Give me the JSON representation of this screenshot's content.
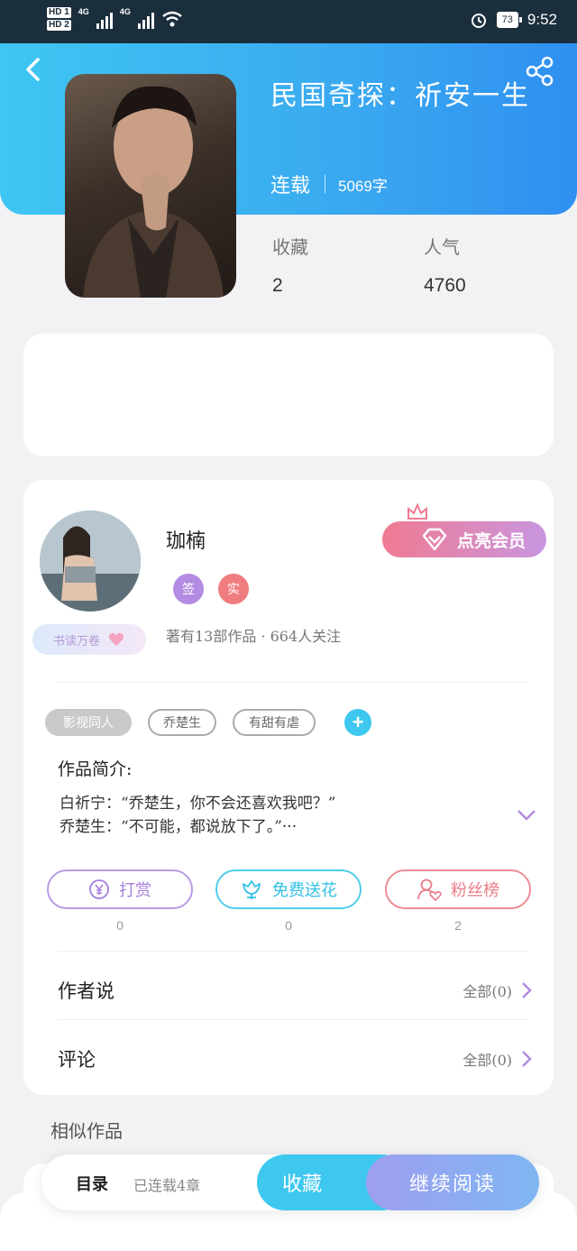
{
  "status_bar": {
    "hd1": "HD 1",
    "hd2": "HD 2",
    "net1": "4G",
    "net2": "4G",
    "battery": "73",
    "time": "9:52"
  },
  "book": {
    "title": "民国奇探：祈安一生",
    "status": "连载",
    "word_count": "5069字",
    "favorites_label": "收藏",
    "favorites_value": "2",
    "popularity_label": "人气",
    "popularity_value": "4760"
  },
  "author": {
    "name": "珈楠",
    "badge_text": "书读万卷",
    "tag_signed": "签",
    "tag_verified": "实",
    "stats": "著有13部作品 · 664人关注",
    "vip_button": "点亮会员"
  },
  "tags": [
    "影视同人",
    "乔楚生",
    "有甜有虐"
  ],
  "intro": {
    "heading": "作品简介:",
    "text": "白祈宁：“乔楚生，你不会还喜欢我吧？”\n乔楚生：“不可能，都说放下了。”···"
  },
  "actions": [
    {
      "label": "打赏",
      "count": "0"
    },
    {
      "label": "免费送花",
      "count": "0"
    },
    {
      "label": "粉丝榜",
      "count": "2"
    }
  ],
  "rows": {
    "author_says": {
      "title": "作者说",
      "meta": "全部(0)"
    },
    "comments": {
      "title": "评论",
      "meta": "全部(0)"
    }
  },
  "similar_heading": "相似作品",
  "bottom_bar": {
    "toc": "目录",
    "chapters": "已连载4章",
    "favorite": "收藏",
    "continue": "继续阅读"
  },
  "colors": {
    "header_blue": "#3aa9f0",
    "accent_cyan": "#3ec8ef",
    "accent_purple": "#b38be0",
    "accent_pink": "#e87b86"
  }
}
